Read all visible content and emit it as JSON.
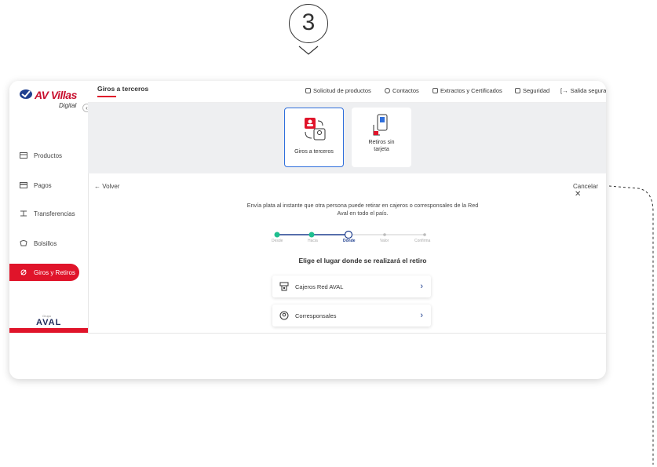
{
  "step_marker": {
    "number": "3"
  },
  "logo": {
    "brand": "AV Villas",
    "sub": "Digital"
  },
  "sidebar": {
    "items": [
      {
        "label": "Productos",
        "icon": "wallet-icon"
      },
      {
        "label": "Pagos",
        "icon": "card-icon"
      },
      {
        "label": "Transferencias",
        "icon": "transfer-icon"
      },
      {
        "label": "Bolsillos",
        "icon": "pocket-icon"
      },
      {
        "label": "Giros y Retiros",
        "icon": "giros-icon",
        "active": true
      }
    ],
    "footer_brand": "AVAL",
    "footer_small": "Grupo"
  },
  "header": {
    "title": "Giros a terceros",
    "links": [
      {
        "label": "Solicitud de productos",
        "icon": "bag-icon"
      },
      {
        "label": "Contactos",
        "icon": "user-icon"
      },
      {
        "label": "Extractos y Certificados",
        "icon": "document-icon"
      },
      {
        "label": "Seguridad",
        "icon": "lock-icon"
      },
      {
        "label": "Salida segura",
        "icon": "logout-icon"
      }
    ]
  },
  "cards": [
    {
      "label": "Giros a terceros",
      "selected": true
    },
    {
      "label": "Retiros sin tarjeta",
      "selected": false
    }
  ],
  "nav": {
    "back": "Volver",
    "cancel": "Cancelar"
  },
  "intro": "Envía plata al instante que otra persona puede retirar en cajeros o corresponsales de la Red Aval en todo el país.",
  "stepper": {
    "steps": [
      "Desde",
      "Hacia",
      "Dónde",
      "Valor",
      "Confirma"
    ],
    "current_index": 2
  },
  "question": "Elige el lugar donde se realizará el retiro",
  "options": [
    {
      "label": "Cajeros Red AVAL",
      "icon": "atm-icon"
    },
    {
      "label": "Corresponsales",
      "icon": "location-pin-icon"
    }
  ],
  "colors": {
    "brand_red": "#e0142a",
    "accent_blue": "#2f6fdc",
    "step_green": "#1fbf8f",
    "navy": "#1f3f8f"
  }
}
